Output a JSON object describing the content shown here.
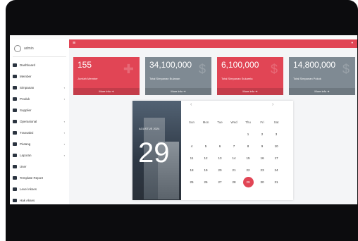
{
  "user": {
    "name": "admin"
  },
  "sidebar": {
    "items": [
      {
        "label": "Dashboard",
        "icon": "monitor-icon",
        "has_children": false
      },
      {
        "label": "Member",
        "icon": "id-card-icon",
        "has_children": false
      },
      {
        "label": "Simpanan",
        "icon": "wallet-icon",
        "has_children": true
      },
      {
        "label": "Produk",
        "icon": "box-icon",
        "has_children": true
      },
      {
        "label": "Supplier",
        "icon": "truck-icon",
        "has_children": false
      },
      {
        "label": "Operasional",
        "icon": "list-icon",
        "has_children": true
      },
      {
        "label": "Transaksi",
        "icon": "cart-icon",
        "has_children": true
      },
      {
        "label": "Piutang",
        "icon": "document-icon",
        "has_children": true
      },
      {
        "label": "Laporan",
        "icon": "gear-icon",
        "has_children": true
      },
      {
        "label": "User",
        "icon": "user-icon",
        "has_children": false
      },
      {
        "label": "Template Report",
        "icon": "template-icon",
        "has_children": false
      },
      {
        "label": "Level Akses",
        "icon": "users-icon",
        "has_children": false
      },
      {
        "label": "Hak Akses",
        "icon": "users-key-icon",
        "has_children": false
      }
    ]
  },
  "cards": [
    {
      "value": "155",
      "label": "Jumlah Member",
      "more": "More info",
      "icon": "user-plus-icon",
      "color": "#e14555"
    },
    {
      "value": "34,100,000",
      "label": "Total Simpanan Bulanan",
      "more": "More info",
      "icon": "dollar-icon",
      "color": "#7f8a93"
    },
    {
      "value": "6,100,000",
      "label": "Total Simpanan Sukarela",
      "more": "More info",
      "icon": "dollar-icon",
      "color": "#e14555"
    },
    {
      "value": "14,800,000",
      "label": "Total Simpanan Pokok",
      "more": "More info",
      "icon": "dollar-icon",
      "color": "#7f8a93"
    }
  ],
  "calendar": {
    "month_label": "AGUSTUS 2024",
    "big_day": "29",
    "dow": [
      "Sun",
      "Mon",
      "Tue",
      "Wed",
      "Thu",
      "Fri",
      "Sat"
    ],
    "weeks": [
      [
        "",
        "",
        "",
        "",
        "1",
        "2",
        "3"
      ],
      [
        "4",
        "5",
        "6",
        "7",
        "8",
        "9",
        "10"
      ],
      [
        "11",
        "12",
        "13",
        "14",
        "15",
        "16",
        "17"
      ],
      [
        "18",
        "19",
        "20",
        "21",
        "22",
        "23",
        "24"
      ],
      [
        "25",
        "26",
        "27",
        "28",
        "29",
        "30",
        "31"
      ]
    ],
    "selected": "29"
  }
}
